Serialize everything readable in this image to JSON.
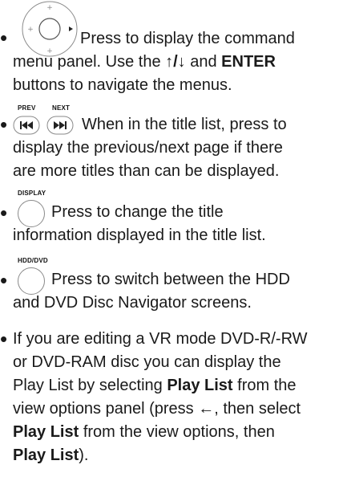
{
  "items": [
    {
      "lines": [
        [
          "Press to display the command"
        ],
        [
          "menu panel. Use the ",
          "↑/↓",
          " and ",
          "ENTER"
        ],
        [
          "buttons to navigate the menus."
        ]
      ]
    },
    {
      "icon_captions": [
        "PREV",
        "NEXT"
      ],
      "lines": [
        [
          "When in the title list, press to"
        ],
        [
          "display the previous/next page if there"
        ],
        [
          "are more titles than can be displayed."
        ]
      ]
    },
    {
      "icon_caption": "DISPLAY",
      "lines": [
        [
          "Press to change the title"
        ],
        [
          "information displayed in the title list."
        ]
      ]
    },
    {
      "icon_caption": "HDD/DVD",
      "lines": [
        [
          "Press to switch between the HDD"
        ],
        [
          "and DVD Disc Navigator screens."
        ]
      ]
    },
    {
      "lines": [
        [
          "If you are editing a VR mode DVD-R/-RW"
        ],
        [
          "or DVD-RAM disc you can display the"
        ],
        [
          "Play List by selecting ",
          "Play List",
          " from the"
        ],
        [
          "view options panel (press ",
          "←",
          ", then select"
        ],
        [
          "Play List",
          " from the view options, then"
        ],
        [
          "Play List",
          ")."
        ]
      ]
    }
  ],
  "icons": {
    "joystick": "directional-pad-icon",
    "prev": "skip-back-icon",
    "next": "skip-forward-icon",
    "display": "round-button-icon",
    "hdd_dvd": "round-button-icon"
  }
}
